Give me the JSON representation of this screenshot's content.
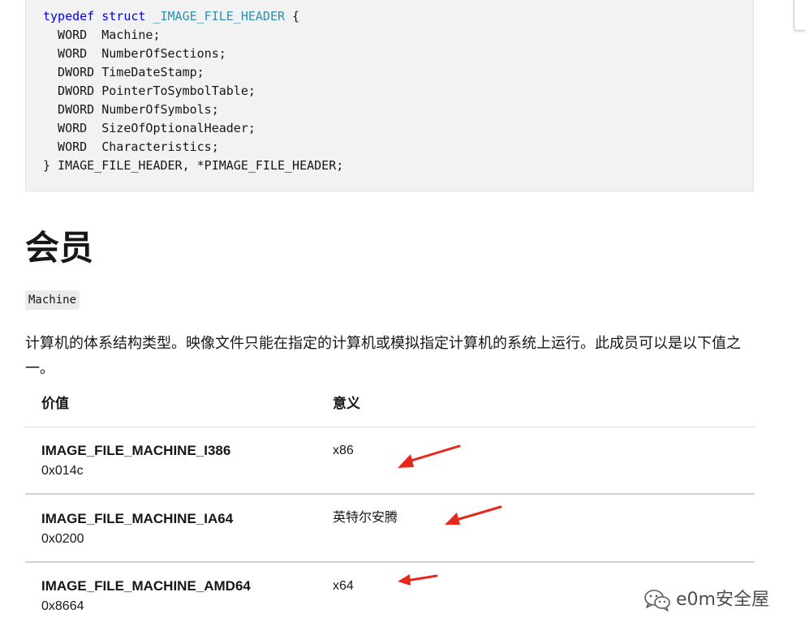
{
  "code": {
    "lines": [
      {
        "parts": [
          {
            "t": "typedef",
            "c": "kw"
          },
          {
            "t": " "
          },
          {
            "t": "struct",
            "c": "kw"
          },
          {
            "t": " "
          },
          {
            "t": "_IMAGE_FILE_HEADER",
            "c": "tn"
          },
          {
            "t": " {"
          }
        ]
      },
      {
        "parts": [
          {
            "t": "  WORD  Machine;"
          }
        ]
      },
      {
        "parts": [
          {
            "t": "  WORD  NumberOfSections;"
          }
        ]
      },
      {
        "parts": [
          {
            "t": "  DWORD TimeDateStamp;"
          }
        ]
      },
      {
        "parts": [
          {
            "t": "  DWORD PointerToSymbolTable;"
          }
        ]
      },
      {
        "parts": [
          {
            "t": "  DWORD NumberOfSymbols;"
          }
        ]
      },
      {
        "parts": [
          {
            "t": "  WORD  SizeOfOptionalHeader;"
          }
        ]
      },
      {
        "parts": [
          {
            "t": "  WORD  Characteristics;"
          }
        ]
      },
      {
        "parts": [
          {
            "t": "} IMAGE_FILE_HEADER, *PIMAGE_FILE_HEADER;"
          }
        ]
      }
    ]
  },
  "section": {
    "title": "会员",
    "member_code": "Machine",
    "description": "计算机的体系结构类型。映像文件只能在指定的计算机或模拟指定计算机的系统上运行。此成员可以是以下值之一。"
  },
  "table": {
    "headers": {
      "value": "价值",
      "meaning": "意义"
    },
    "rows": [
      {
        "name": "IMAGE_FILE_MACHINE_I386",
        "hex": "0x014c",
        "meaning": "x86"
      },
      {
        "name": "IMAGE_FILE_MACHINE_IA64",
        "hex": "0x0200",
        "meaning": "英特尔安腾"
      },
      {
        "name": "IMAGE_FILE_MACHINE_AMD64",
        "hex": "0x8664",
        "meaning": "x64"
      }
    ]
  },
  "annotations": {
    "arrow_color": "#e8271c",
    "arrow_icon": "red-arrow-icon"
  },
  "watermark": {
    "icon": "wechat-icon",
    "text": "e0m安全屋"
  },
  "colors": {
    "keyword": "#0000ff",
    "type_name": "#2b91af",
    "code_background": "#f2f2f2"
  }
}
